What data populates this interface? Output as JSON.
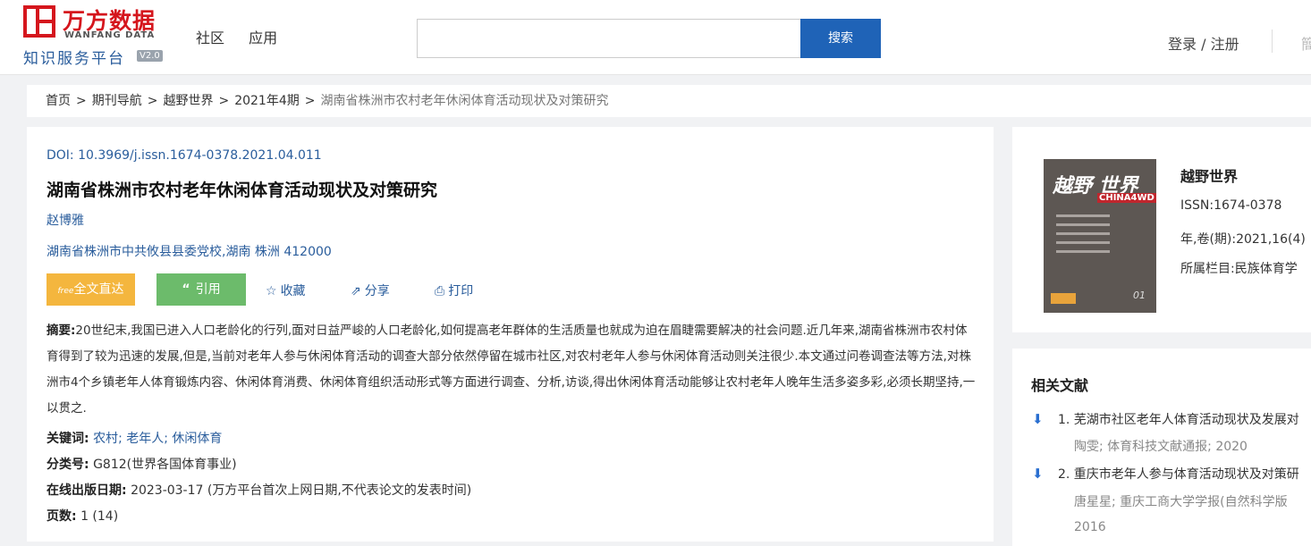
{
  "header": {
    "logo": {
      "cn": "万方数据",
      "en": "WANFANG DATA",
      "sub": "知识服务平台",
      "version": "V2.0"
    },
    "nav": [
      "社区",
      "应用"
    ],
    "search": {
      "value": "",
      "placeholder": "",
      "button": "搜索"
    },
    "login": "登录 / 注册",
    "cut_text": "簡"
  },
  "breadcrumb": [
    "首页",
    "期刊导航",
    "越野世界",
    "2021年4期",
    "湖南省株洲市农村老年休闲体育活动现状及对策研究"
  ],
  "article": {
    "doi_label": "DOI:",
    "doi": "10.3969/j.issn.1674-0378.2021.04.011",
    "title": "湖南省株洲市农村老年休闲体育活动现状及对策研究",
    "author": "赵博雅",
    "org": "湖南省株洲市中共攸县县委党校,湖南 株洲 412000",
    "buttons": {
      "full_text": "全文直达",
      "free_badge": "free",
      "cite": "引用",
      "collect": "收藏",
      "share": "分享",
      "print": "打印"
    },
    "abstract_label": "摘要:",
    "abstract": "20世纪末,我国已进入人口老龄化的行列,面对日益严峻的人口老龄化,如何提高老年群体的生活质量也就成为迫在眉睫需要解决的社会问题.近几年来,湖南省株洲市农村体育得到了较为迅速的发展,但是,当前对老年人参与休闲体育活动的调查大部分依然停留在城市社区,对农村老年人参与休闲体育活动则关注很少.本文通过问卷调查法等方法,对株洲市4个乡镇老年人体育锻炼内容、休闲体育消费、休闲体育组织活动形式等方面进行调查、分析,访谈,得出休闲体育活动能够让农村老年人晚年生活多姿多彩,必须长期坚持,一以贯之.",
    "keywords_label": "关键词:",
    "keywords": [
      "农村",
      "老年人",
      "休闲体育"
    ],
    "class_label": "分类号:",
    "class_value": "G812(世界各国体育事业)",
    "pubdate_label": "在线出版日期:",
    "pubdate_value": "2023-03-17 (万方平台首次上网日期,不代表论文的发表时间)",
    "pages_label": "页数:",
    "pages_value": "1 (14)"
  },
  "journal": {
    "name": "越野世界",
    "issn": "ISSN:1674-0378",
    "volume": "年,卷(期):2021,16(4)",
    "column": "所属栏目:民族体育学",
    "cover_title": "越野 世界",
    "cover_sub": "CHINA4WD",
    "cover_num": "01"
  },
  "related": {
    "heading": "相关文献",
    "items": [
      {
        "title": "1. 芜湖市社区老年人体育活动现状及发展对",
        "meta": "陶雯; 体育科技文献通报; 2020",
        "meta2": ""
      },
      {
        "title": "2. 重庆市老年人参与体育活动现状及对策研",
        "meta": "唐星星; 重庆工商大学学报(自然科学版",
        "meta2": "2016"
      }
    ]
  }
}
